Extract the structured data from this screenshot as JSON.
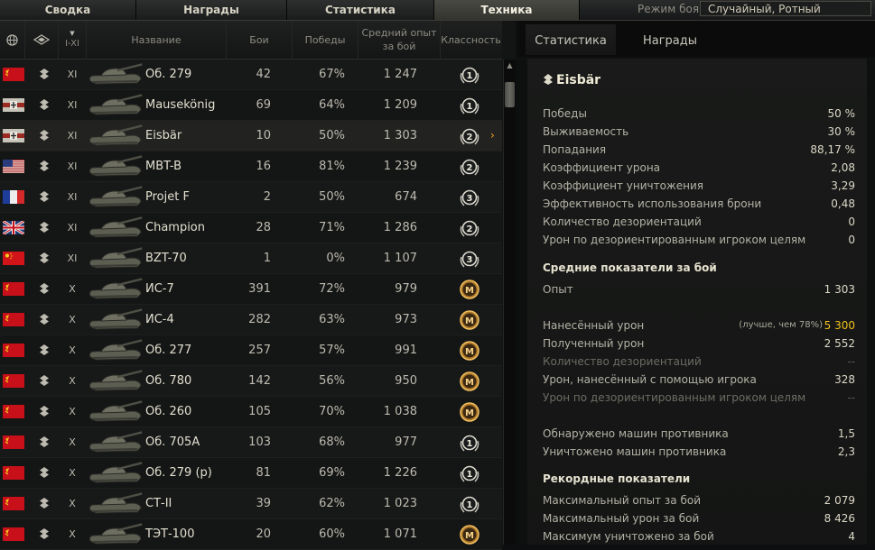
{
  "top_tabs": [
    "Сводка",
    "Награды",
    "Статистика",
    "Техника"
  ],
  "battle_mode": {
    "label": "Режим боя:",
    "value": "Случайный, Ротный"
  },
  "columns": {
    "tier": "I-XI",
    "name": "Название",
    "battles": "Бои",
    "wins": "Победы",
    "exp": "Средний опыт за бой",
    "mastery": "Классность"
  },
  "vehicles": [
    {
      "flag": "ussr",
      "tier": "XI",
      "name": "Об. 279",
      "battles": "42",
      "wins": "67%",
      "exp": "1 247",
      "mastery": "1"
    },
    {
      "flag": "germany",
      "tier": "XI",
      "name": "Mausekönig",
      "battles": "69",
      "wins": "64%",
      "exp": "1 209",
      "mastery": "1"
    },
    {
      "flag": "germany",
      "tier": "XI",
      "name": "Eisbär",
      "battles": "10",
      "wins": "50%",
      "exp": "1 303",
      "mastery": "2"
    },
    {
      "flag": "usa",
      "tier": "XI",
      "name": "MBT-B",
      "battles": "16",
      "wins": "81%",
      "exp": "1 239",
      "mastery": "2"
    },
    {
      "flag": "france",
      "tier": "XI",
      "name": "Projet F",
      "battles": "2",
      "wins": "50%",
      "exp": "674",
      "mastery": "3"
    },
    {
      "flag": "uk",
      "tier": "XI",
      "name": "Champion",
      "battles": "28",
      "wins": "71%",
      "exp": "1 286",
      "mastery": "2"
    },
    {
      "flag": "china",
      "tier": "XI",
      "name": "BZT-70",
      "battles": "1",
      "wins": "0%",
      "exp": "1 107",
      "mastery": "3"
    },
    {
      "flag": "ussr",
      "tier": "X",
      "name": "ИС-7",
      "battles": "391",
      "wins": "72%",
      "exp": "979",
      "mastery": "M"
    },
    {
      "flag": "ussr",
      "tier": "X",
      "name": "ИС-4",
      "battles": "282",
      "wins": "63%",
      "exp": "973",
      "mastery": "M"
    },
    {
      "flag": "ussr",
      "tier": "X",
      "name": "Об. 277",
      "battles": "257",
      "wins": "57%",
      "exp": "991",
      "mastery": "M"
    },
    {
      "flag": "ussr",
      "tier": "X",
      "name": "Об. 780",
      "battles": "142",
      "wins": "56%",
      "exp": "950",
      "mastery": "M"
    },
    {
      "flag": "ussr",
      "tier": "X",
      "name": "Об. 260",
      "battles": "105",
      "wins": "70%",
      "exp": "1 038",
      "mastery": "M"
    },
    {
      "flag": "ussr",
      "tier": "X",
      "name": "Об. 705А",
      "battles": "103",
      "wins": "68%",
      "exp": "977",
      "mastery": "1"
    },
    {
      "flag": "ussr",
      "tier": "X",
      "name": "Об. 279 (р)",
      "battles": "81",
      "wins": "69%",
      "exp": "1 226",
      "mastery": "1"
    },
    {
      "flag": "ussr",
      "tier": "X",
      "name": "СТ-II",
      "battles": "39",
      "wins": "62%",
      "exp": "1 023",
      "mastery": "1"
    },
    {
      "flag": "ussr",
      "tier": "X",
      "name": "ТЭТ-100",
      "battles": "20",
      "wins": "60%",
      "exp": "1 071",
      "mastery": "M"
    }
  ],
  "right_tabs": [
    "Статистика",
    "Награды"
  ],
  "vehicle_name": "Eisbär",
  "stats": [
    {
      "label": "Победы",
      "value": "50 %"
    },
    {
      "label": "Выживаемость",
      "value": "30 %"
    },
    {
      "label": "Попадания",
      "value": "88,17 %"
    },
    {
      "label": "Коэффициент урона",
      "value": "2,08"
    },
    {
      "label": "Коэффициент уничтожения",
      "value": "3,29"
    },
    {
      "label": "Эффективность использования брони",
      "value": "0,48"
    },
    {
      "label": "Количество дезориентаций",
      "value": "0"
    },
    {
      "label": "Урон по дезориентированным игроком целям",
      "value": "0"
    }
  ],
  "avg_section": "Средние показатели за бой",
  "avg_exp": {
    "label": "Опыт",
    "value": "1 303"
  },
  "damage_block": [
    {
      "label": "Нанесённый урон",
      "value": "5 300",
      "note": "(лучше, чем 78%)",
      "highlight": true
    },
    {
      "label": "Полученный урон",
      "value": "2 552"
    },
    {
      "label": "Количество дезориентаций",
      "value": "--",
      "dim": true
    },
    {
      "label": "Урон, нанесённый с помощью игрока",
      "value": "328"
    },
    {
      "label": "Урон по дезориентированным игроком целям",
      "value": "--",
      "dim": true
    }
  ],
  "spot_block": [
    {
      "label": "Обнаружено машин противника",
      "value": "1,5"
    },
    {
      "label": "Уничтожено машин противника",
      "value": "2,3"
    }
  ],
  "record_section": "Рекордные показатели",
  "records": [
    {
      "label": "Максимальный опыт за бой",
      "value": "2 079"
    },
    {
      "label": "Максимальный урон за бой",
      "value": "8 426"
    },
    {
      "label": "Максимум уничтожено за бой",
      "value": "4"
    }
  ],
  "colors": {
    "accent_gold": "#f2c21a",
    "arrow": "#f0a020"
  },
  "icons": {
    "globe": "globe-icon",
    "vehicle_type": "vehicle-type-icon",
    "sort": "sort-arrow-icon",
    "scroll_up": "scroll-up-icon"
  }
}
